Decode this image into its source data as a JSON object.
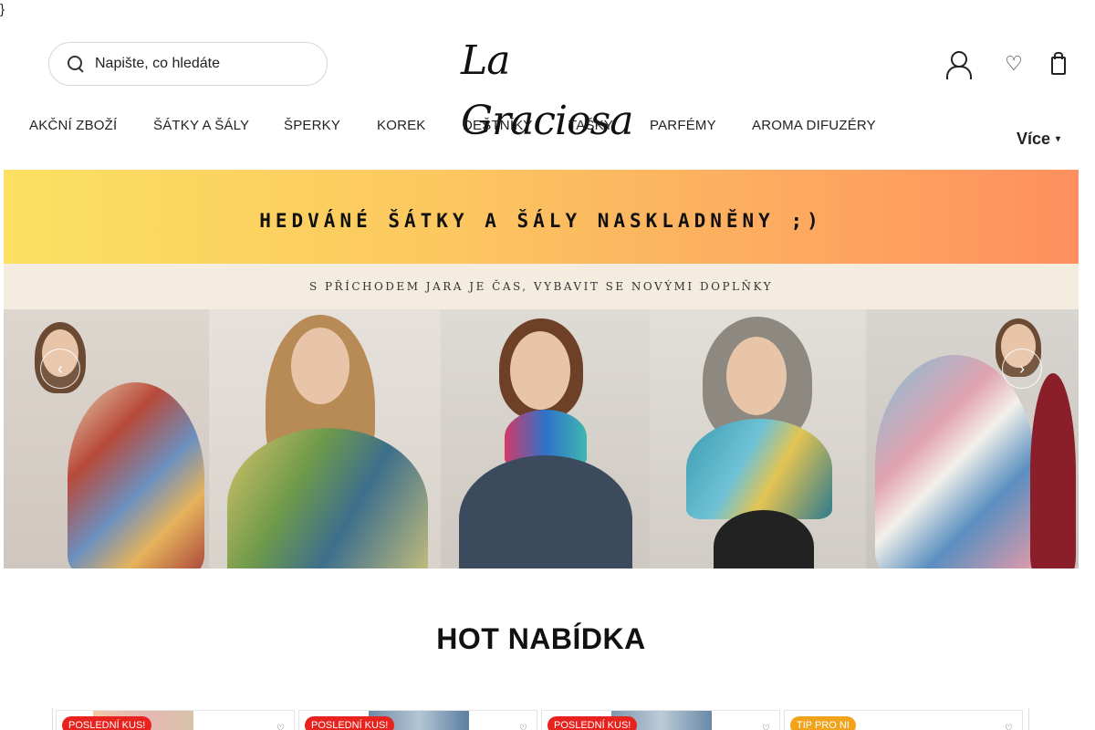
{
  "stray_text": "}",
  "search": {
    "placeholder": "Napište, co hledáte"
  },
  "logo": {
    "text": "La Graciosa"
  },
  "nav": {
    "items": [
      "AKČNÍ ZBOŽÍ",
      "ŠÁTKY A ŠÁLY",
      "ŠPERKY",
      "KOREK",
      "DEŠTNÍKY",
      "TAŠKY",
      "PARFÉMY",
      "AROMA DIFUZÉRY"
    ],
    "more_label": "Více"
  },
  "banner": {
    "headline": "HEDVÁNÉ ŠÁTKY A ŠÁLY NASKLADNĚNY ;)",
    "subline": "S PŘÍCHODEM JARA JE ČAS, VYBAVIT SE NOVÝMI DOPLŇKY",
    "colors": {
      "gradient_start": "#fbe062",
      "gradient_end": "#fe8f5e",
      "subline_bg": "#f4ecdf"
    }
  },
  "section": {
    "title": "HOT NABÍDKA"
  },
  "products": [
    {
      "badge": "POSLEDNÍ KUS!",
      "badge_color": "#e8231e"
    },
    {
      "badge": "POSLEDNÍ KUS!",
      "badge_color": "#e8231e"
    },
    {
      "badge": "POSLEDNÍ KUS!",
      "badge_color": "#e8231e"
    },
    {
      "badge": "TIP PRO NI",
      "badge_color": "#f1a31c"
    }
  ],
  "icons": {
    "search": "search-icon",
    "user": "user-icon",
    "wishlist": "heart-icon",
    "cart": "cart-icon",
    "more": "chevron-down-icon",
    "prev": "chevron-left-icon",
    "next": "chevron-right-icon"
  }
}
